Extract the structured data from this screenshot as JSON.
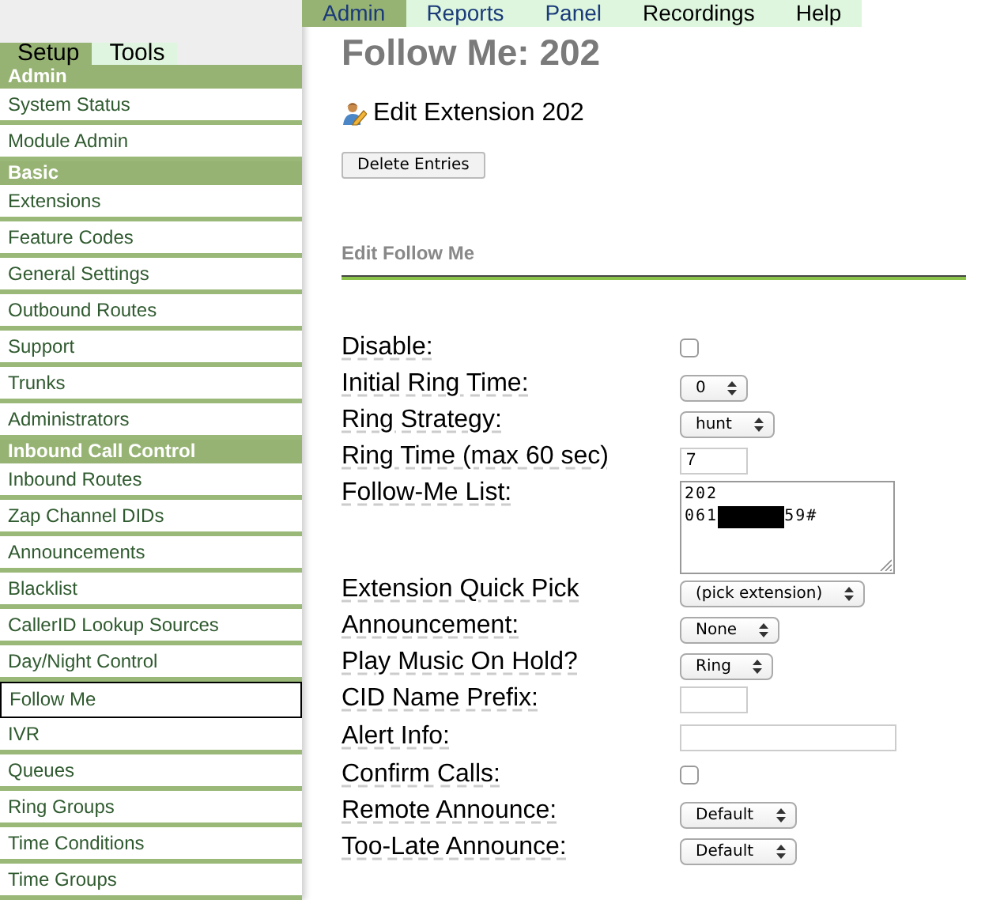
{
  "top_nav": [
    {
      "label": "Admin",
      "selected": true,
      "visited": true
    },
    {
      "label": "Reports",
      "selected": false,
      "visited": true
    },
    {
      "label": "Panel",
      "selected": false,
      "visited": true
    },
    {
      "label": "Recordings",
      "selected": false,
      "visited": false
    },
    {
      "label": "Help",
      "selected": false,
      "visited": false
    }
  ],
  "sidebar": {
    "tabs": [
      {
        "label": "Setup",
        "selected": true
      },
      {
        "label": "Tools",
        "selected": false
      }
    ],
    "sections": [
      {
        "title": "Admin",
        "items": [
          {
            "label": "System Status",
            "selected": false
          },
          {
            "label": "Module Admin",
            "selected": false
          }
        ]
      },
      {
        "title": "Basic",
        "items": [
          {
            "label": "Extensions",
            "selected": false
          },
          {
            "label": "Feature Codes",
            "selected": false
          },
          {
            "label": "General Settings",
            "selected": false
          },
          {
            "label": "Outbound Routes",
            "selected": false
          },
          {
            "label": "Support",
            "selected": false
          },
          {
            "label": "Trunks",
            "selected": false
          },
          {
            "label": "Administrators",
            "selected": false
          }
        ]
      },
      {
        "title": "Inbound Call Control",
        "items": [
          {
            "label": "Inbound Routes",
            "selected": false
          },
          {
            "label": "Zap Channel DIDs",
            "selected": false
          },
          {
            "label": "Announcements",
            "selected": false
          },
          {
            "label": "Blacklist",
            "selected": false
          },
          {
            "label": "CallerID Lookup Sources",
            "selected": false
          },
          {
            "label": "Day/Night Control",
            "selected": false
          },
          {
            "label": "Follow Me",
            "selected": true
          },
          {
            "label": "IVR",
            "selected": false
          },
          {
            "label": "Queues",
            "selected": false
          },
          {
            "label": "Ring Groups",
            "selected": false
          },
          {
            "label": "Time Conditions",
            "selected": false
          },
          {
            "label": "Time Groups",
            "selected": false
          }
        ]
      }
    ]
  },
  "page_title": "Follow Me: 202",
  "edit_link": "Edit Extension 202",
  "delete_button": "Delete Entries",
  "section_title": "Edit Follow Me",
  "form": [
    {
      "label": "Disable:",
      "kind": "checkbox",
      "checked": false
    },
    {
      "label": "Initial Ring Time:",
      "kind": "select",
      "value": "0"
    },
    {
      "label": "Ring Strategy:",
      "kind": "select",
      "value": "hunt"
    },
    {
      "label": "Ring Time (max 60 sec)",
      "kind": "text",
      "value": "7"
    },
    {
      "label": "Follow-Me List:",
      "kind": "textarea",
      "lines": [
        {
          "text": "202"
        },
        {
          "text": "061",
          "redacted": true,
          "after": "59#"
        }
      ]
    },
    {
      "label": "Extension Quick Pick",
      "kind": "select",
      "value": "(pick extension)"
    },
    {
      "label": "Announcement:",
      "kind": "select",
      "value": "None"
    },
    {
      "label": "Play Music On Hold?",
      "kind": "select",
      "value": "Ring"
    },
    {
      "label": "CID Name Prefix:",
      "kind": "text"
    },
    {
      "label": "Alert Info:",
      "kind": "wide_text"
    },
    {
      "label": "Confirm Calls:",
      "kind": "checkbox",
      "checked": false
    },
    {
      "label": "Remote Announce:",
      "kind": "select",
      "value": "Default"
    },
    {
      "label": "Too-Late Announce:",
      "kind": "select",
      "value": "Default"
    }
  ]
}
